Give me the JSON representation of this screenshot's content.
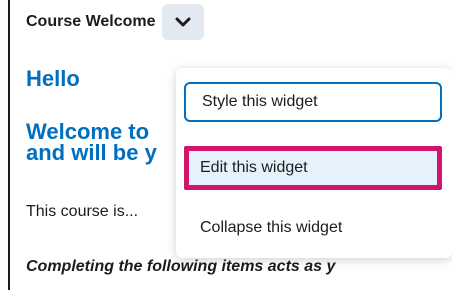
{
  "widget": {
    "title": "Course Welcome",
    "heading": "Hello",
    "welcome_line1": "Welcome to",
    "welcome_line2": "and will be y",
    "course_text": "This course is...",
    "italic_text": "Completing the following items acts as y"
  },
  "menu": {
    "items": [
      {
        "label": "Style this widget"
      },
      {
        "label": "Edit this widget"
      },
      {
        "label": "Collapse this widget"
      }
    ]
  },
  "colors": {
    "accent_blue": "#006fbf",
    "highlight_magenta": "#d1146e",
    "chevron_bg": "#e3e9f1"
  },
  "icons": {
    "chevron": "chevron-down-icon"
  }
}
